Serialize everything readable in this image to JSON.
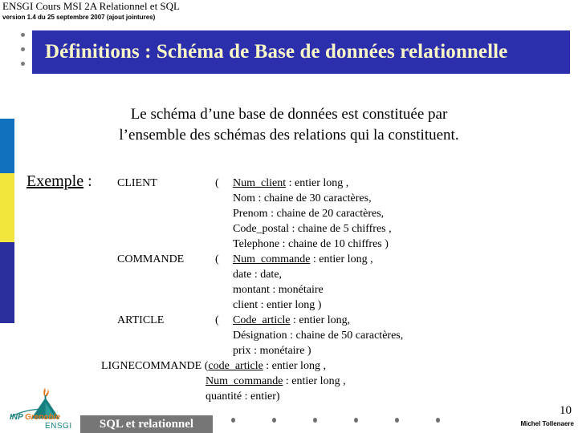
{
  "header": {
    "title": "ENSGI Cours MSI 2A Relationnel et SQL",
    "version": "version 1.4  du 25 septembre 2007 (ajout jointures)"
  },
  "banner": {
    "title": "Définitions : Schéma de Base de données relationnelle",
    "background_color": "#2b2fab",
    "text_color": "#fbf8c8"
  },
  "intro": {
    "line1": "Le schéma d’une base de données est constituée par",
    "line2": "l’ensemble des schémas des relations qui la constituent."
  },
  "example": {
    "label_underlined": "Exemple",
    "label_suffix": " :"
  },
  "relations": [
    {
      "name": "CLIENT",
      "open_paren": "(",
      "attributes": [
        {
          "key": "Num_client",
          "is_pk": true,
          "rest": " : entier long ,"
        },
        {
          "key": "Nom",
          "is_pk": false,
          "rest": " : chaine de 30 caractères,"
        },
        {
          "key": "Prenom",
          "is_pk": false,
          "rest": " : chaine de 20 caractères,"
        },
        {
          "key": "Code_postal",
          "is_pk": false,
          "rest": " : chaine de 5 chiffres ,"
        },
        {
          "key": "Telephone",
          "is_pk": false,
          "rest": " : chaine de 10 chiffres   )"
        }
      ]
    },
    {
      "name": "COMMANDE",
      "open_paren": "(",
      "attributes": [
        {
          "key": "Num_commande",
          "is_pk": true,
          "rest": " : entier long ,"
        },
        {
          "key": "date",
          "is_pk": false,
          "rest": " : date,"
        },
        {
          "key": "montant",
          "is_pk": false,
          "rest": " : monétaire"
        },
        {
          "key": "client",
          "is_pk": false,
          "rest": " : entier long )"
        }
      ]
    },
    {
      "name": "ARTICLE",
      "open_paren": "(",
      "attributes": [
        {
          "key": "Code_article",
          "is_pk": true,
          "rest": " : entier long,"
        },
        {
          "key": "Désignation",
          "is_pk": false,
          "rest": " : chaine de 50 caractères,"
        },
        {
          "key": "prix",
          "is_pk": false,
          "rest": " : monétaire )"
        }
      ]
    },
    {
      "name": "LIGNECOMMANDE",
      "open_paren": "(",
      "attributes": [
        {
          "key": "code_article",
          "is_pk": true,
          "rest": " : entier long ,"
        },
        {
          "key": "Num_commande",
          "is_pk": true,
          "rest": " : entier long ,"
        },
        {
          "key": "quantité",
          "is_pk": false,
          "rest": " : entier)"
        }
      ]
    }
  ],
  "footer": {
    "bar_label": "SQL et relationnel",
    "bar_color": "#767676",
    "page_number": "10",
    "author": "Michel Tollenaere",
    "dot_count": 6
  },
  "logo": {
    "inp": "INP",
    "grenoble": "Grenoble",
    "ensgi": "ENSGI",
    "teal": "#17807f",
    "orange": "#e8751a"
  },
  "decor": {
    "title_dot_count": 3,
    "bar_blue_light": "#1271be",
    "bar_yellow": "#f2e63c",
    "bar_blue_dark": "#2b2f9e"
  }
}
